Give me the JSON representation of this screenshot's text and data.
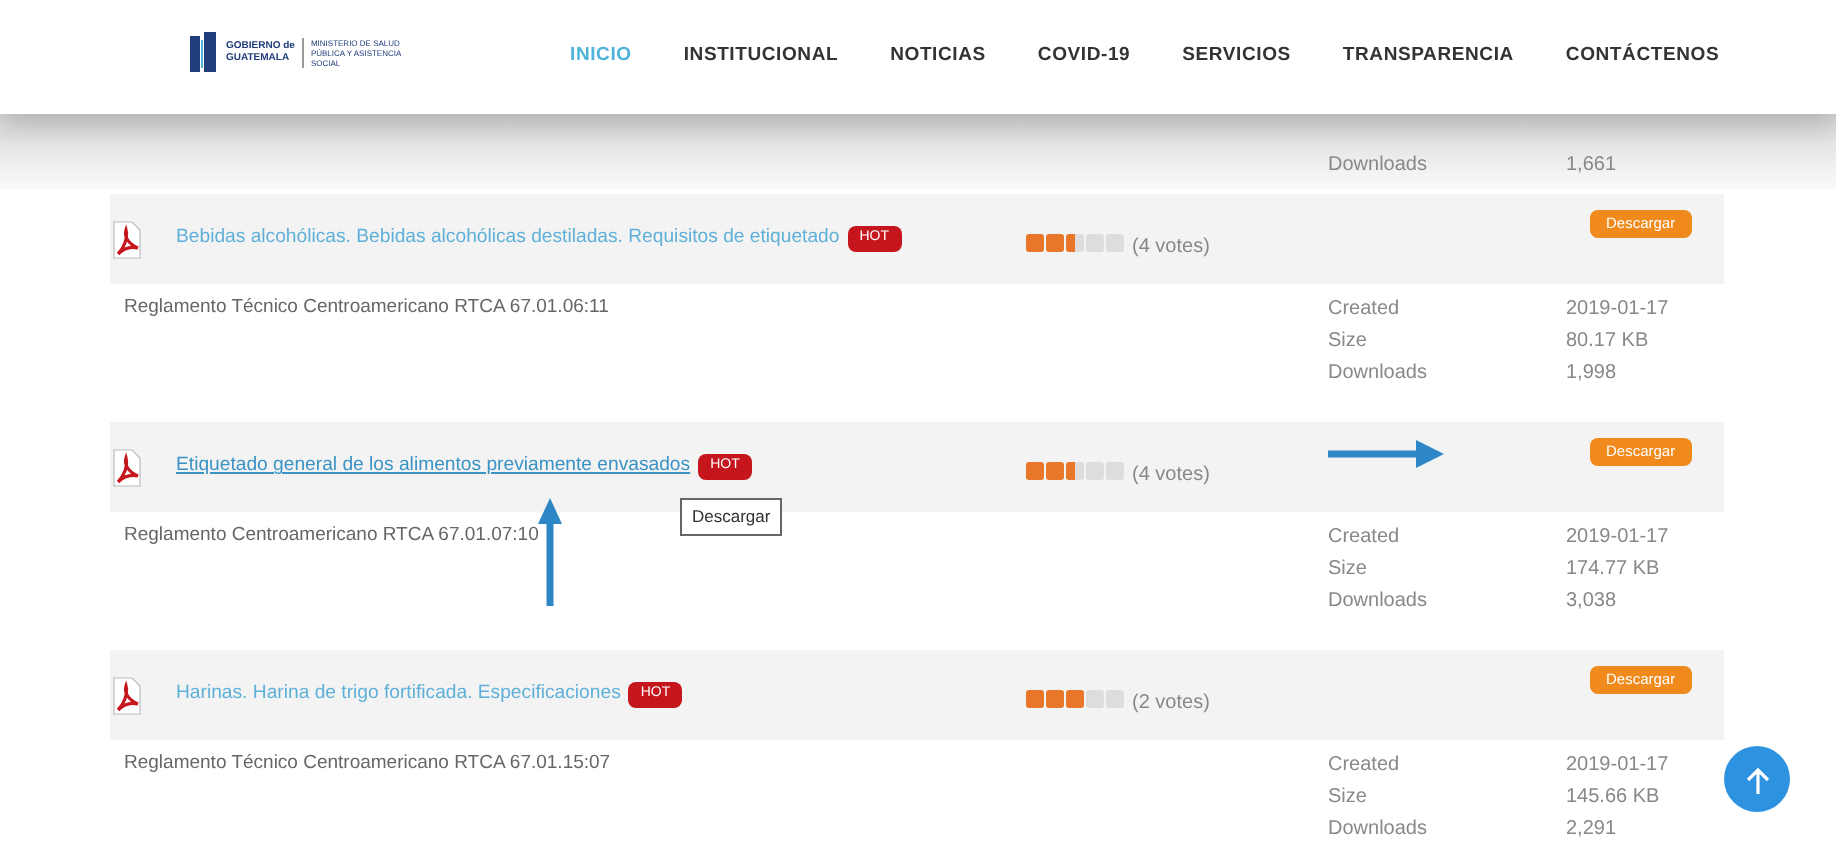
{
  "header": {
    "logo": {
      "line_1": "GOBIERNO de",
      "line_2": "GUATEMALA",
      "ministry": "MINISTERIO DE SALUD PÚBLICA Y ASISTENCIA SOCIAL"
    },
    "nav": [
      {
        "label": "INICIO",
        "selected": true
      },
      {
        "label": "INSTITUCIONAL",
        "selected": false
      },
      {
        "label": "NOTICIAS",
        "selected": false
      },
      {
        "label": "COVID-19",
        "selected": false
      },
      {
        "label": "SERVICIOS",
        "selected": false
      },
      {
        "label": "TRANSPARENCIA",
        "selected": false
      },
      {
        "label": "CONTÁCTENOS",
        "selected": false
      }
    ]
  },
  "previous_document": {
    "meta": [
      {
        "label": "Downloads",
        "value": "1,661"
      }
    ]
  },
  "documents": [
    {
      "title": "Bebidas alcohólicas. Bebidas alcohólicas destiladas. Requisitos de etiquetado",
      "hot": "HOT",
      "stars": 2.5,
      "votes": "(4 votes)",
      "button": "Descargar",
      "hovered": false,
      "description": "Reglamento Técnico Centroamericano RTCA 67.01.06:11",
      "meta": [
        {
          "label": "Created",
          "value": "2019-01-17"
        },
        {
          "label": "Size",
          "value": "80.17 KB"
        },
        {
          "label": "Downloads",
          "value": "1,998"
        }
      ]
    },
    {
      "title": "Etiquetado general de los alimentos previamente envasados",
      "hot": "HOT",
      "stars": 2.5,
      "votes": "(4 votes)",
      "button": "Descargar",
      "hovered": true,
      "tooltip": "Descargar",
      "arrow_to_link": true,
      "arrow_to_button": true,
      "description": "Reglamento Centroamericano RTCA 67.01.07:10",
      "meta": [
        {
          "label": "Created",
          "value": "2019-01-17"
        },
        {
          "label": "Size",
          "value": "174.77 KB"
        },
        {
          "label": "Downloads",
          "value": "3,038"
        }
      ]
    },
    {
      "title": "Harinas. Harina de trigo fortificada. Especificaciones",
      "hot": "HOT",
      "stars": 3,
      "votes": "(2 votes)",
      "button": "Descargar",
      "hovered": false,
      "description": "Reglamento Técnico Centroamericano RTCA 67.01.15:07",
      "meta": [
        {
          "label": "Created",
          "value": "2019-01-17"
        },
        {
          "label": "Size",
          "value": "145.66 KB"
        },
        {
          "label": "Downloads",
          "value": "2,291"
        }
      ]
    }
  ]
}
